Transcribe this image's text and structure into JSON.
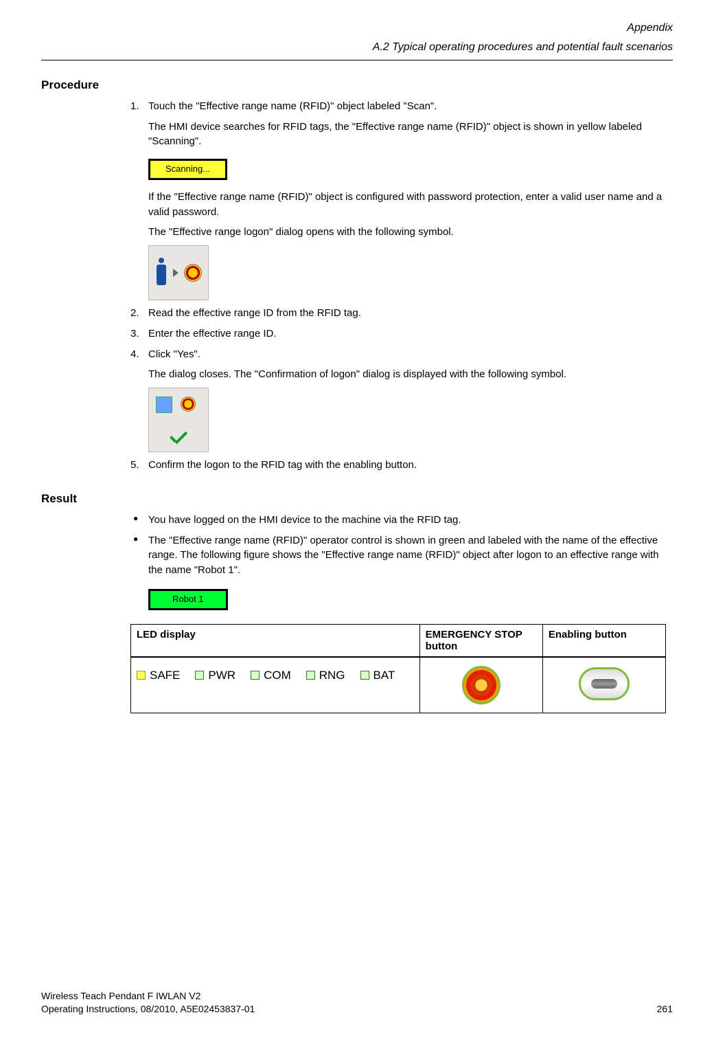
{
  "header": {
    "line1": "Appendix",
    "line2": "A.2 Typical operating procedures and potential fault scenarios"
  },
  "sections": {
    "procedure_title": "Procedure",
    "result_title": "Result"
  },
  "procedure": {
    "step1": {
      "text": "Touch the \"Effective range name (RFID)\" object labeled \"Scan\".",
      "sub1": "The HMI device searches for RFID tags, the \"Effective range name (RFID)\" object is shown in yellow labeled \"Scanning\".",
      "scan_label": "Scanning...",
      "sub2": "If the \"Effective range name (RFID)\" object is configured with password protection, enter a valid user name and a valid password.",
      "sub3": "The \"Effective range logon\" dialog opens with the following symbol."
    },
    "step2": "Read the effective range ID from the RFID tag.",
    "step3": "Enter the effective range ID.",
    "step4": {
      "text": "Click \"Yes\".",
      "sub1": "The dialog closes. The \"Confirmation of logon\" dialog is displayed with the following symbol."
    },
    "step5": "Confirm the logon to the RFID tag with the enabling button."
  },
  "result": {
    "b1": "You have logged on the HMI device to the machine via the RFID tag.",
    "b2": "The \"Effective range name (RFID)\" operator control is shown in green and labeled with the name of the effective range. The following figure shows the \"Effective range name (RFID)\" object after logon to an effective range with the name \"Robot 1\".",
    "green_label": "Robot 1"
  },
  "table": {
    "h1": "LED display",
    "h2": "EMERGENCY STOP button",
    "h3": "Enabling button",
    "leds": {
      "safe": "SAFE",
      "pwr": "PWR",
      "com": "COM",
      "rng": "RNG",
      "bat": "BAT"
    }
  },
  "footer": {
    "left1": "Wireless Teach Pendant F IWLAN V2",
    "left2": "Operating Instructions, 08/2010, A5E02453837-01",
    "page": "261"
  }
}
